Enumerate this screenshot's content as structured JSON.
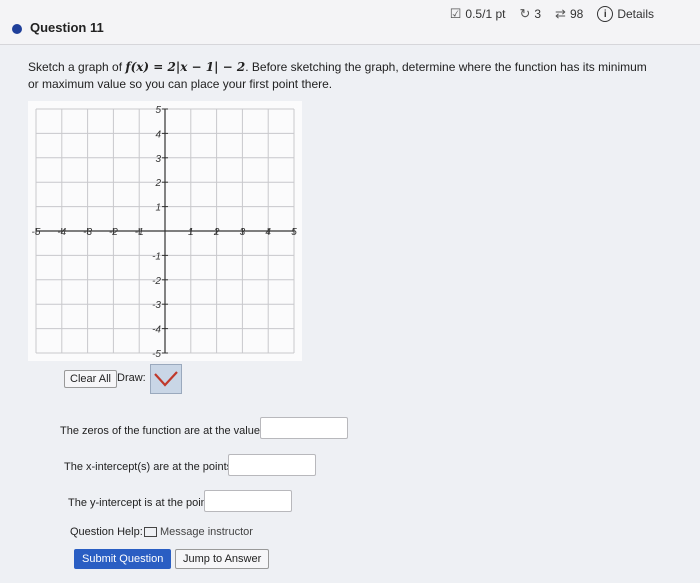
{
  "header": {
    "question_title": "Question 11",
    "score": "0.5/1 pt",
    "retries": "3",
    "attempts": "98",
    "details": "Details"
  },
  "prompt": {
    "before": "Sketch a graph of ",
    "function": "f(x) = 2|x − 1| − 2",
    "after": ". Before sketching the graph, determine where the function has its minimum or maximum value so you can place your first point there."
  },
  "graph": {
    "x_ticks": [
      "-5",
      "-4",
      "-3",
      "-2",
      "-1",
      "1",
      "2",
      "3",
      "4",
      "5"
    ],
    "y_ticks": [
      "5",
      "4",
      "3",
      "2",
      "1",
      "-1",
      "-2",
      "-3",
      "-4",
      "-5"
    ],
    "xlim": [
      -5,
      5
    ],
    "ylim": [
      -5,
      5
    ]
  },
  "tools": {
    "clear_all": "Clear All",
    "draw_label": "Draw:"
  },
  "questions": {
    "zeros": "The zeros of the function are at the values",
    "x_intercepts": "The x-intercept(s) are at the points",
    "y_intercept": "The y-intercept is at the point"
  },
  "help": {
    "label": "Question Help:",
    "message": "Message instructor"
  },
  "buttons": {
    "submit": "Submit Question",
    "jump": "Jump to Answer"
  }
}
